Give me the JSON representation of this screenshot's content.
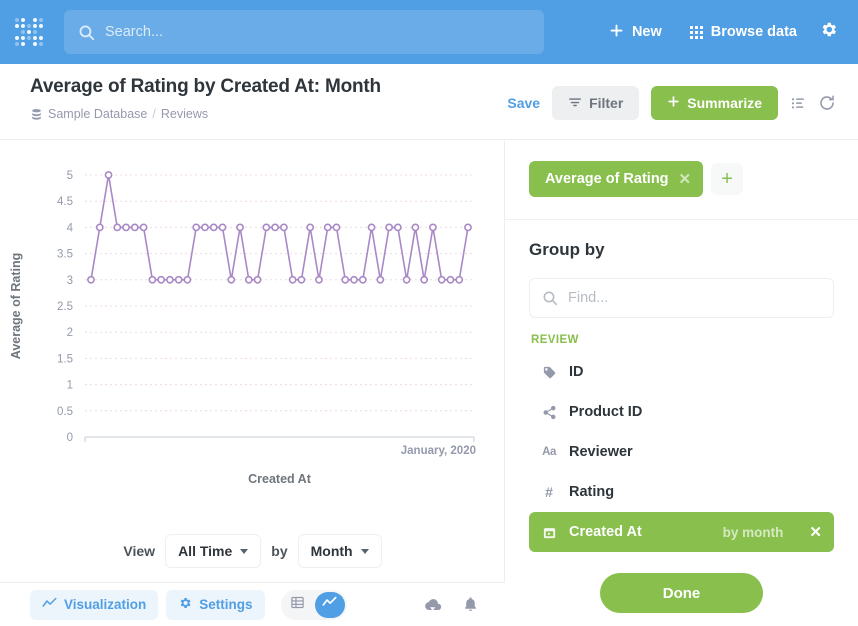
{
  "topnav": {
    "logo_icon": "metabase-logo-icon",
    "search": {
      "placeholder": "Search...",
      "value": "",
      "icon": "search-icon"
    },
    "new_label": "New",
    "new_icon": "plus-icon",
    "browse_label": "Browse data",
    "browse_icon": "grid-icon",
    "settings_icon": "gear-icon",
    "bg_color": "#509EE3"
  },
  "question_header": {
    "title": "Average of Rating by Created At: Month",
    "breadcrumb": {
      "database_icon": "database-icon",
      "database": "Sample Database",
      "separator": "/",
      "table": "Reviews"
    },
    "save_label": "Save",
    "filter_label": "Filter",
    "filter_icon": "filter-icon",
    "summarize_label": "Summarize",
    "summarize_icon": "plus-icon",
    "summarize_color": "#88BF4D",
    "list_view_icon": "list-icon",
    "refresh_icon": "refresh-icon"
  },
  "chart_data": {
    "type": "line",
    "title": "",
    "xlabel": "Created At",
    "ylabel": "Average of Rating",
    "ylim": [
      0,
      5
    ],
    "ytick_labels": [
      "5",
      "4.5",
      "4",
      "3.5",
      "3",
      "2.5",
      "2",
      "1.5",
      "1",
      "0.5",
      "0"
    ],
    "ytick_values": [
      5,
      4.5,
      4,
      3.5,
      3,
      2.5,
      2,
      1.5,
      1,
      0.5,
      0
    ],
    "xtick_labels": [
      "January, 2020"
    ],
    "xtick_positions": [
      1.0
    ],
    "grid": true,
    "legend": "none",
    "line_color": "#A989C5",
    "marker": "open-circle",
    "values": [
      3,
      4,
      5,
      4,
      4,
      4,
      4,
      3,
      3,
      3,
      3,
      3,
      4,
      4,
      4,
      4,
      3,
      4,
      3,
      3,
      4,
      4,
      4,
      3,
      3,
      4,
      3,
      4,
      4,
      3,
      3,
      3,
      4,
      3,
      4,
      4,
      3,
      4,
      3,
      4,
      3,
      3,
      3,
      4
    ],
    "n_points": 44
  },
  "view_controls": {
    "view_label": "View",
    "time_range": "All Time",
    "by_label": "by",
    "granularity": "Month",
    "caret_icon": "chevron-down-icon"
  },
  "bottom_bar": {
    "visualization_label": "Visualization",
    "visualization_icon": "line-chart-icon",
    "settings_label": "Settings",
    "settings_icon": "gear-icon",
    "table_toggle_icon": "table-icon",
    "chart_toggle_icon": "line-chart-icon",
    "active_toggle": "chart",
    "download_icon": "download-icon",
    "alert_icon": "bell-icon"
  },
  "sidebar": {
    "aggregation": {
      "chip_label": "Average of Rating",
      "chip_remove_icon": "close-icon",
      "add_icon": "plus-icon",
      "chip_color": "#88BF4D"
    },
    "group_by": {
      "title": "Group by",
      "find": {
        "placeholder": "Find...",
        "value": "",
        "icon": "search-icon"
      },
      "section_label": "REVIEW",
      "items": [
        {
          "label": "ID",
          "icon": "tag-icon",
          "selected": false,
          "bucket": ""
        },
        {
          "label": "Product ID",
          "icon": "share-icon",
          "selected": false,
          "bucket": ""
        },
        {
          "label": "Reviewer",
          "icon": "text-icon",
          "icon_glyph": "Aa",
          "selected": false,
          "bucket": ""
        },
        {
          "label": "Rating",
          "icon": "number-icon",
          "icon_glyph": "#",
          "selected": false,
          "bucket": ""
        },
        {
          "label": "Created At",
          "icon": "calendar-icon",
          "selected": true,
          "bucket": "by month",
          "remove_icon": "close-icon"
        }
      ]
    },
    "done_label": "Done"
  }
}
